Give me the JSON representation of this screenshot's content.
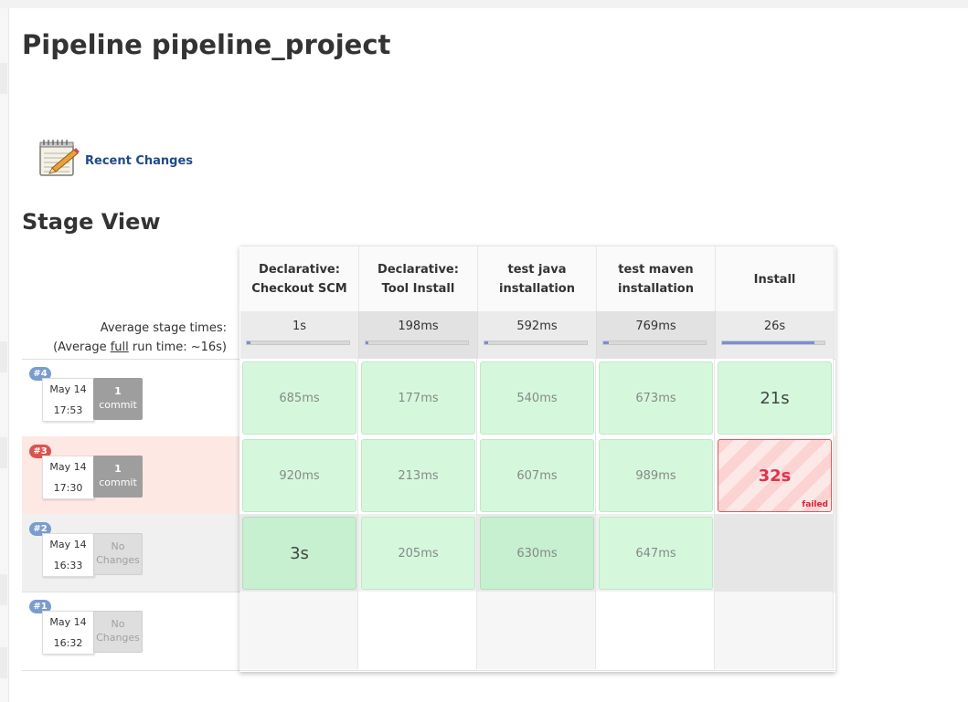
{
  "page": {
    "title": "Pipeline pipeline_project"
  },
  "recent_changes": {
    "label": "Recent Changes",
    "icon": "notepad-icon"
  },
  "stage_view": {
    "title": "Stage View",
    "avg_label_line1": "Average stage times:",
    "avg_label_prefix": "(Average ",
    "avg_label_full": "full",
    "avg_label_suffix": " run time: ~16s)",
    "stages": [
      {
        "line1": "Declarative:",
        "line2": "Checkout SCM",
        "avg": "1s",
        "avg_fraction": 0.04
      },
      {
        "line1": "Declarative:",
        "line2": "Tool Install",
        "avg": "198ms",
        "avg_fraction": 0.03
      },
      {
        "line1": "test java",
        "line2": "installation",
        "avg": "592ms",
        "avg_fraction": 0.04
      },
      {
        "line1": "test maven",
        "line2": "installation",
        "avg": "769ms",
        "avg_fraction": 0.05
      },
      {
        "line1": "Install",
        "line2": "",
        "avg": "26s",
        "avg_fraction": 0.9
      }
    ],
    "builds": [
      {
        "id": "#4",
        "date": "May 14",
        "time": "17:53",
        "commit_count": "1",
        "commit_label": "commit",
        "status": "success",
        "cells": [
          "685ms",
          "177ms",
          "540ms",
          "673ms",
          "21s"
        ]
      },
      {
        "id": "#3",
        "date": "May 14",
        "time": "17:30",
        "commit_count": "1",
        "commit_label": "commit",
        "status": "failed",
        "cells": [
          "920ms",
          "213ms",
          "607ms",
          "989ms",
          "32s"
        ],
        "failed_label": "failed"
      },
      {
        "id": "#2",
        "date": "May 14",
        "time": "16:33",
        "commit_count": "No",
        "commit_label": "Changes",
        "status": "success",
        "cells": [
          "3s",
          "205ms",
          "630ms",
          "647ms",
          ""
        ]
      },
      {
        "id": "#1",
        "date": "May 14",
        "time": "16:32",
        "commit_count": "No",
        "commit_label": "Changes",
        "status": "unknown",
        "cells": [
          "",
          "",
          "",
          "",
          ""
        ]
      }
    ]
  }
}
